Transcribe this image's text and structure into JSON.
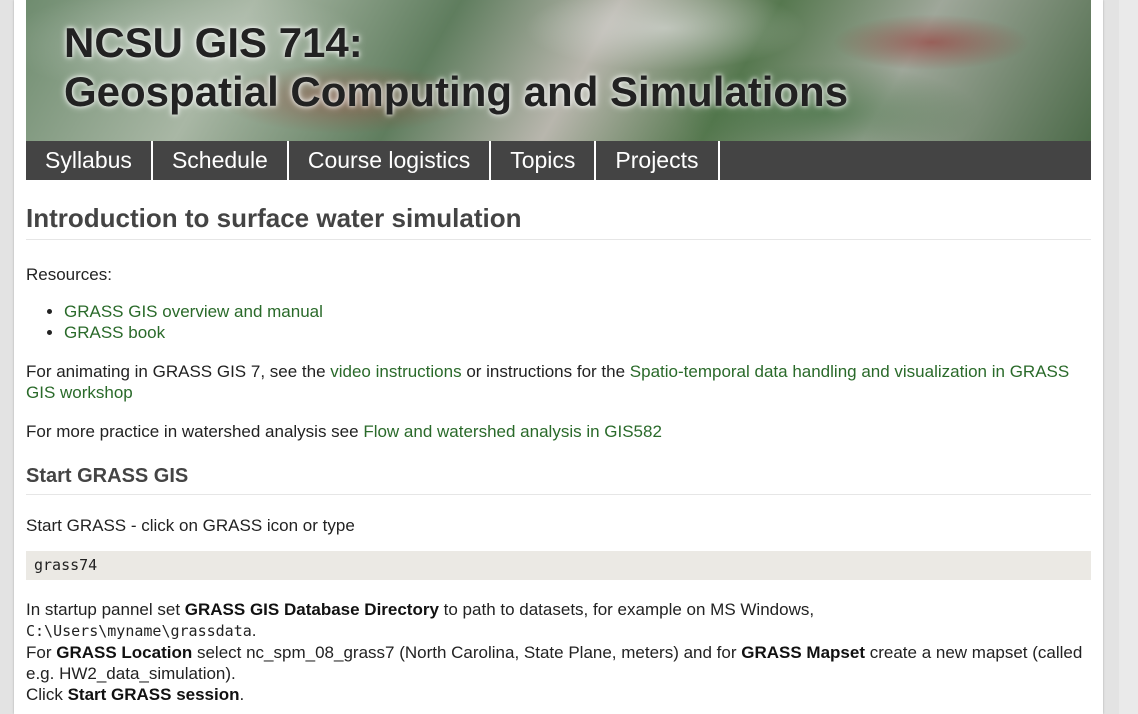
{
  "banner": {
    "title_line1": "NCSU GIS 714:",
    "title_line2": "Geospatial Computing and Simulations"
  },
  "nav": {
    "items": [
      {
        "label": "Syllabus"
      },
      {
        "label": "Schedule"
      },
      {
        "label": "Course logistics"
      },
      {
        "label": "Topics"
      },
      {
        "label": "Projects"
      }
    ]
  },
  "content": {
    "heading": "Introduction to surface water simulation",
    "resources_label": "Resources:",
    "resource_links": [
      {
        "label": "GRASS GIS overview and manual"
      },
      {
        "label": "GRASS book"
      }
    ],
    "animating": {
      "prefix": "For animating in GRASS GIS 7, see the ",
      "video_link": "video instructions",
      "middle": " or instructions for the ",
      "workshop_link": "Spatio-temporal data handling and visualization in GRASS GIS workshop"
    },
    "practice": {
      "prefix": "For more practice in watershed analysis see ",
      "link": "Flow and watershed analysis in GIS582"
    },
    "start_heading": "Start GRASS GIS",
    "start_line": "Start GRASS - click on GRASS icon or type",
    "code": "grass74",
    "startup": {
      "t1": "In startup pannel set ",
      "b1": "GRASS GIS Database Directory",
      "t2": " to path to datasets, for example on MS Windows,",
      "path": "C:\\Users\\myname\\grassdata",
      "t3": ".",
      "t4": "For ",
      "b2": "GRASS Location",
      "t5": " select nc_spm_08_grass7 (North Carolina, State Plane, meters) and for ",
      "b3": "GRASS Mapset",
      "t6": " create a new mapset (called e.g. HW2_data_simulation).",
      "t7": "Click ",
      "b4": "Start GRASS session",
      "t8": "."
    }
  }
}
